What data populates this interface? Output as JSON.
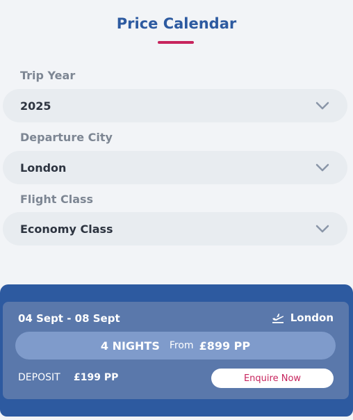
{
  "header": {
    "title": "Price Calendar"
  },
  "filters": {
    "trip_year": {
      "label": "Trip Year",
      "value": "2025"
    },
    "departure_city": {
      "label": "Departure City",
      "value": "London"
    },
    "flight_class": {
      "label": "Flight Class",
      "value": "Economy Class"
    }
  },
  "result": {
    "dates": "04 Sept - 08 Sept",
    "city": "London",
    "nights": "4 NIGHTS",
    "from_label": "From",
    "price": "£899 PP",
    "deposit_label": "DEPOSIT",
    "deposit_value": "£199 PP",
    "enquire_label": "Enquire Now"
  },
  "icons": {
    "chevron": "chevron-down-icon",
    "plane": "plane-departure-icon"
  },
  "colors": {
    "accent": "#2d5aa0",
    "underline": "#c7245d",
    "card": "#5a78ab",
    "pill": "#7f9bcb"
  }
}
